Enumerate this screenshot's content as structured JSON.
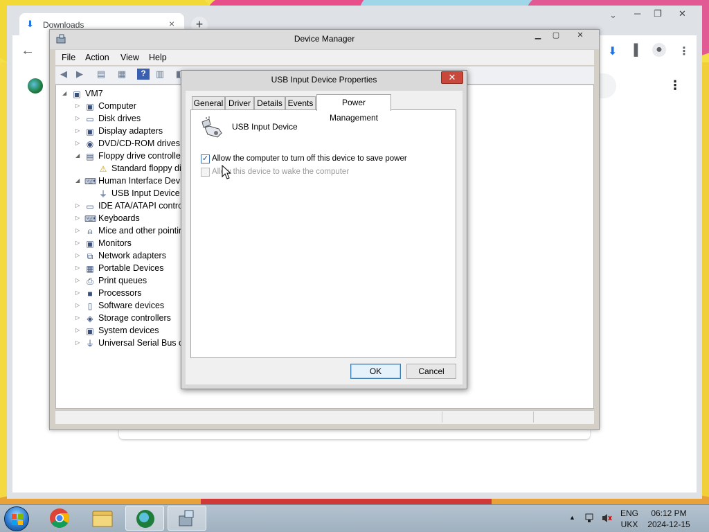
{
  "browser": {
    "tab_title": "Downloads",
    "tab_close": "×",
    "new_tab": "+",
    "win_minimize": "─",
    "win_restore": "❐",
    "win_close": "✕",
    "back": "←",
    "menu": "⋮",
    "page_menu": "⋮"
  },
  "device_manager": {
    "title": "Device Manager",
    "menu": [
      "File",
      "Action",
      "View",
      "Help"
    ],
    "tree": [
      {
        "label": "VM7",
        "expander": "◢",
        "icon": "computer-icon"
      },
      {
        "label": "Computer",
        "expander": "▷",
        "icon": "computer-icon"
      },
      {
        "label": "Disk drives",
        "expander": "▷",
        "icon": "disk-drive-icon"
      },
      {
        "label": "Display adapters",
        "expander": "▷",
        "icon": "display-adapter-icon"
      },
      {
        "label": "DVD/CD-ROM drives",
        "expander": "▷",
        "icon": "dvd-drive-icon"
      },
      {
        "label": "Floppy drive controllers",
        "expander": "◢",
        "icon": "floppy-controller-icon"
      },
      {
        "label": "Standard floppy disk controller",
        "expander": "",
        "icon": "floppy-warning-icon"
      },
      {
        "label": "Human Interface Devices",
        "expander": "◢",
        "icon": "hid-icon"
      },
      {
        "label": "USB Input Device",
        "expander": "",
        "icon": "usb-device-icon"
      },
      {
        "label": "IDE ATA/ATAPI controllers",
        "expander": "▷",
        "icon": "ide-controller-icon"
      },
      {
        "label": "Keyboards",
        "expander": "▷",
        "icon": "keyboard-icon"
      },
      {
        "label": "Mice and other pointing devices",
        "expander": "▷",
        "icon": "mouse-icon"
      },
      {
        "label": "Monitors",
        "expander": "▷",
        "icon": "monitor-icon"
      },
      {
        "label": "Network adapters",
        "expander": "▷",
        "icon": "network-adapter-icon"
      },
      {
        "label": "Portable Devices",
        "expander": "▷",
        "icon": "portable-device-icon"
      },
      {
        "label": "Print queues",
        "expander": "▷",
        "icon": "printer-icon"
      },
      {
        "label": "Processors",
        "expander": "▷",
        "icon": "processor-icon"
      },
      {
        "label": "Software devices",
        "expander": "▷",
        "icon": "software-device-icon"
      },
      {
        "label": "Storage controllers",
        "expander": "▷",
        "icon": "storage-controller-icon"
      },
      {
        "label": "System devices",
        "expander": "▷",
        "icon": "system-device-icon"
      },
      {
        "label": "Universal Serial Bus controllers",
        "expander": "▷",
        "icon": "usb-controller-icon"
      }
    ]
  },
  "dialog": {
    "title": "USB Input Device Properties",
    "close": "✕",
    "tabs": [
      "General",
      "Driver",
      "Details",
      "Events",
      "Power Management"
    ],
    "active_tab": "Power Management",
    "device_name": "USB Input Device",
    "options": [
      {
        "label": "Allow the computer to turn off this device to save power",
        "checked": true,
        "enabled": true
      },
      {
        "label": "Allow this device to wake the computer",
        "checked": false,
        "enabled": false
      }
    ],
    "ok_label": "OK",
    "cancel_label": "Cancel"
  },
  "taskbar": {
    "language_top": "ENG",
    "language_bottom": "UKX",
    "time": "06:12 PM",
    "date": "2024-12-15",
    "tray_arrow": "▲"
  },
  "colors": {
    "dialog_close": "#c9473b",
    "checkbox_accent": "#3c6db0",
    "default_button": "#e5f1fb",
    "chrome_accent": "#1a73e8"
  }
}
